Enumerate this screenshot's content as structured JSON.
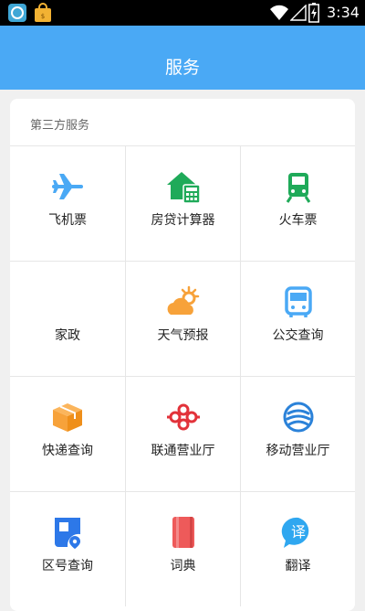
{
  "status_bar": {
    "time": "3:34"
  },
  "app_bar": {
    "title": "服务"
  },
  "section": {
    "title": "第三方服务"
  },
  "services": [
    {
      "label": "飞机票",
      "icon": "airplane-icon",
      "color": "#4aa9f5"
    },
    {
      "label": "房贷计算器",
      "icon": "house-calculator-icon",
      "color": "#1faa59"
    },
    {
      "label": "火车票",
      "icon": "train-icon",
      "color": "#1faa59"
    },
    {
      "label": "家政",
      "icon": "",
      "color": ""
    },
    {
      "label": "天气预报",
      "icon": "weather-icon",
      "color": "#f7a23a"
    },
    {
      "label": "公交查询",
      "icon": "bus-icon",
      "color": "#4aa9f5"
    },
    {
      "label": "快递查询",
      "icon": "package-icon",
      "color": "#f7a23a"
    },
    {
      "label": "联通营业厅",
      "icon": "unicom-logo-icon",
      "color": "#e2323a"
    },
    {
      "label": "移动营业厅",
      "icon": "mobile-logo-icon",
      "color": "#2b82d9"
    },
    {
      "label": "区号查询",
      "icon": "area-code-icon",
      "color": "#2d78e8"
    },
    {
      "label": "词典",
      "icon": "dictionary-icon",
      "color": "#ee5a5a"
    },
    {
      "label": "翻译",
      "icon": "translate-icon",
      "color": "#2fa7f0"
    }
  ]
}
